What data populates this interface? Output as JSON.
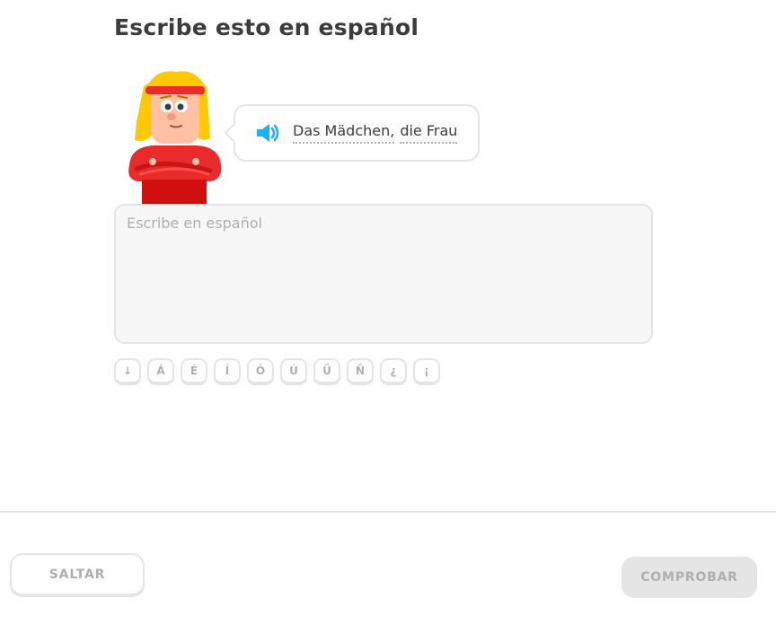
{
  "header": {
    "title": "Escribe esto en español"
  },
  "prompt": {
    "speaker_icon": "speaker-icon",
    "words": [
      "Das Mädchen,",
      "die Frau"
    ],
    "accent_color": "#1cb0f6"
  },
  "answer": {
    "placeholder": "Escribe en español",
    "value": ""
  },
  "accent_keys": [
    "↓",
    "Á",
    "É",
    "Í",
    "Ó",
    "Ú",
    "Ü",
    "Ñ",
    "¿",
    "¡"
  ],
  "footer": {
    "skip_label": "SALTAR",
    "check_label": "COMPROBAR"
  },
  "colors": {
    "border": "#e5e5e5",
    "disabled_text": "#afafaf",
    "title_text": "#3c3c3c",
    "character_shirt": "#ea2b2b",
    "character_hair": "#ffc800"
  }
}
